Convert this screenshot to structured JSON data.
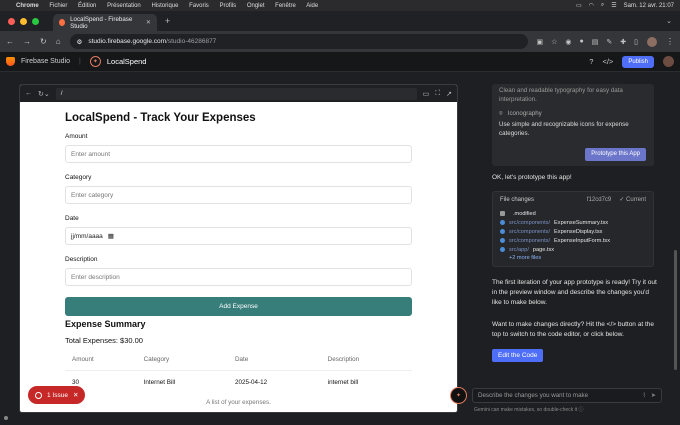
{
  "macbar": {
    "menus": [
      "Chrome",
      "Fichier",
      "Édition",
      "Présentation",
      "Historique",
      "Favoris",
      "Profils",
      "Onglet",
      "Fenêtre",
      "Aide"
    ],
    "datetime": "Sam. 12 avr. 21:07"
  },
  "browser": {
    "tab_title": "LocalSpend - Firebase Studio",
    "url_host": "studio.firebase.google.com",
    "url_path": "/studio-46286877"
  },
  "app": {
    "brand": "Firebase Studio",
    "project": "LocalSpend",
    "publish_label": "Publish"
  },
  "preview": {
    "path": "/",
    "title": "LocalSpend - Track Your Expenses",
    "fields": {
      "amount": {
        "label": "Amount",
        "placeholder": "Enter amount"
      },
      "category": {
        "label": "Category",
        "placeholder": "Enter category"
      },
      "date": {
        "label": "Date",
        "value": "jj/mm/aaaa"
      },
      "description": {
        "label": "Description",
        "placeholder": "Enter description"
      }
    },
    "add_button": "Add Expense",
    "summary_title": "Expense Summary",
    "total": "Total Expenses: $30.00",
    "table": {
      "headers": [
        "Amount",
        "Category",
        "Date",
        "Description"
      ],
      "rows": [
        [
          "30",
          "Internet Bill",
          "2025-04-12",
          "internet bill"
        ]
      ],
      "caption": "A list of your expenses."
    }
  },
  "issue_badge": "1 Issue",
  "chat": {
    "card": {
      "line1": "Clean and readable typography for easy data interpretation.",
      "section": "Iconography",
      "line2": "Use simple and recognizable icons for expense categories.",
      "button": "Prototype this App"
    },
    "msg1": "OK, let's prototype this app!",
    "changes": {
      "title": "File changes",
      "hash": "f12cd7c9",
      "current": "Current",
      "files": [
        {
          "dir": "",
          "name": ".modified"
        },
        {
          "dir": "src/components/",
          "name": "ExpenseSummary.tsx"
        },
        {
          "dir": "src/components/",
          "name": "ExpenseDisplay.tsx"
        },
        {
          "dir": "src/components/",
          "name": "ExpenseInputForm.tsx"
        },
        {
          "dir": "src/app/",
          "name": "page.tsx"
        }
      ],
      "more": "+2 more files"
    },
    "msg2": "The first iteration of your app prototype is ready! Try it out in the preview window and describe the changes you'd like to make below.",
    "msg3": "Want to make changes directly? Hit the </> button at the top to switch to the code editor, or click below.",
    "edit_button": "Edit the Code",
    "input_placeholder": "Describe the changes you want to make",
    "disclaimer": "Gemini can make mistakes, so double-check it"
  }
}
